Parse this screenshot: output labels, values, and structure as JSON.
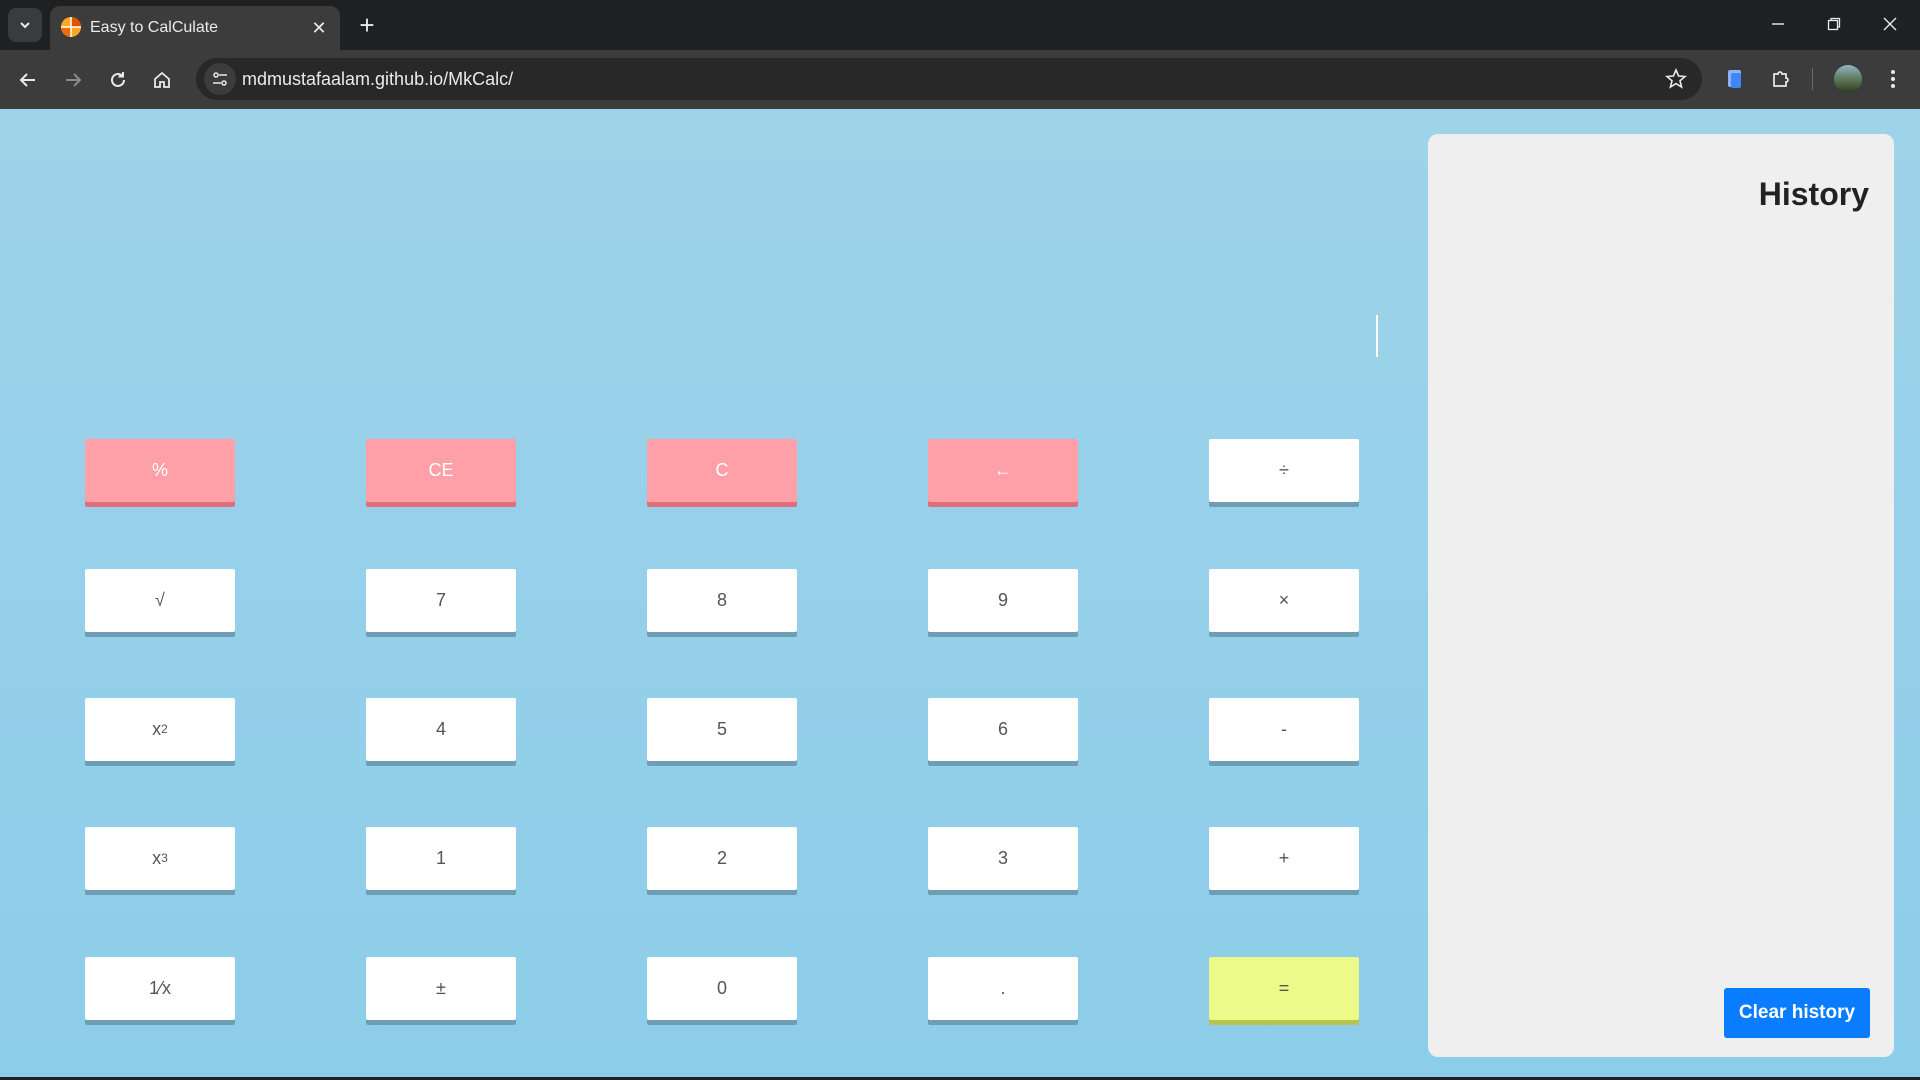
{
  "browser": {
    "tab_title": "Easy to CalCulate",
    "url": "mdmustafaalam.github.io/MkCalc/",
    "favicon_colors": [
      "#f9a825",
      "#e65100",
      "#ffffff"
    ]
  },
  "calculator": {
    "display_value": "",
    "keys": [
      {
        "label": "%",
        "kind": "func"
      },
      {
        "label": "CE",
        "kind": "func"
      },
      {
        "label": "C",
        "kind": "func"
      },
      {
        "label": "←",
        "kind": "func"
      },
      {
        "label": "÷",
        "kind": "op"
      },
      {
        "label": "√",
        "kind": "op"
      },
      {
        "label": "7",
        "kind": "digit"
      },
      {
        "label": "8",
        "kind": "digit"
      },
      {
        "label": "9",
        "kind": "digit"
      },
      {
        "label": "×",
        "kind": "op"
      },
      {
        "label": "x",
        "sup": "2",
        "kind": "op"
      },
      {
        "label": "4",
        "kind": "digit"
      },
      {
        "label": "5",
        "kind": "digit"
      },
      {
        "label": "6",
        "kind": "digit"
      },
      {
        "label": "-",
        "kind": "op"
      },
      {
        "label": "x",
        "sup": "3",
        "kind": "op"
      },
      {
        "label": "1",
        "kind": "digit"
      },
      {
        "label": "2",
        "kind": "digit"
      },
      {
        "label": "3",
        "kind": "digit"
      },
      {
        "label": "+",
        "kind": "op"
      },
      {
        "label": "1⁄x",
        "kind": "op"
      },
      {
        "label": "±",
        "kind": "op"
      },
      {
        "label": "0",
        "kind": "digit"
      },
      {
        "label": ".",
        "kind": "digit"
      },
      {
        "label": "=",
        "kind": "equals"
      }
    ]
  },
  "history": {
    "title": "History",
    "clear_label": "Clear history",
    "entries": []
  },
  "colors": {
    "page_bg": "#9fd3ea",
    "func_key": "#ff9fa8",
    "equals_key": "#ecfa8a",
    "clear_button": "#0a7cff"
  }
}
